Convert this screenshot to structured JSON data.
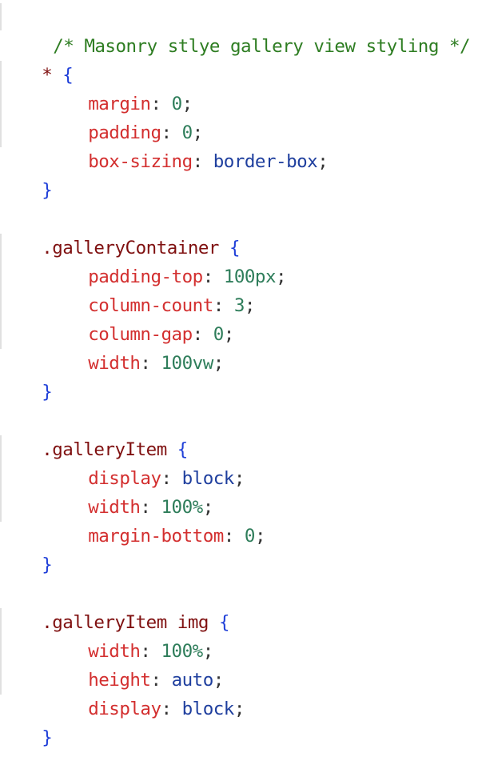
{
  "code": {
    "comment": "/* Masonry stlye gallery view styling */",
    "blocks": [
      {
        "selector": "*",
        "open": "{",
        "close": "}",
        "decls": [
          {
            "prop": "margin",
            "value": "0"
          },
          {
            "prop": "padding",
            "value": "0"
          },
          {
            "prop": "box-sizing",
            "value": "border-box"
          }
        ]
      },
      {
        "selector": ".galleryContainer",
        "open": "{",
        "close": "}",
        "decls": [
          {
            "prop": "padding-top",
            "value": "100px"
          },
          {
            "prop": "column-count",
            "value": "3"
          },
          {
            "prop": "column-gap",
            "value": "0"
          },
          {
            "prop": "width",
            "value": "100vw"
          }
        ]
      },
      {
        "selector": ".galleryItem",
        "open": "{",
        "close": "}",
        "decls": [
          {
            "prop": "display",
            "value": "block"
          },
          {
            "prop": "width",
            "value": "100%"
          },
          {
            "prop": "margin-bottom",
            "value": "0"
          }
        ]
      },
      {
        "selector": ".galleryItem img",
        "open": "{",
        "close": "}",
        "decls": [
          {
            "prop": "width",
            "value": "100%"
          },
          {
            "prop": "height",
            "value": "auto"
          },
          {
            "prop": "display",
            "value": "block"
          }
        ]
      }
    ],
    "colon": ":",
    "semicolon": ";"
  }
}
